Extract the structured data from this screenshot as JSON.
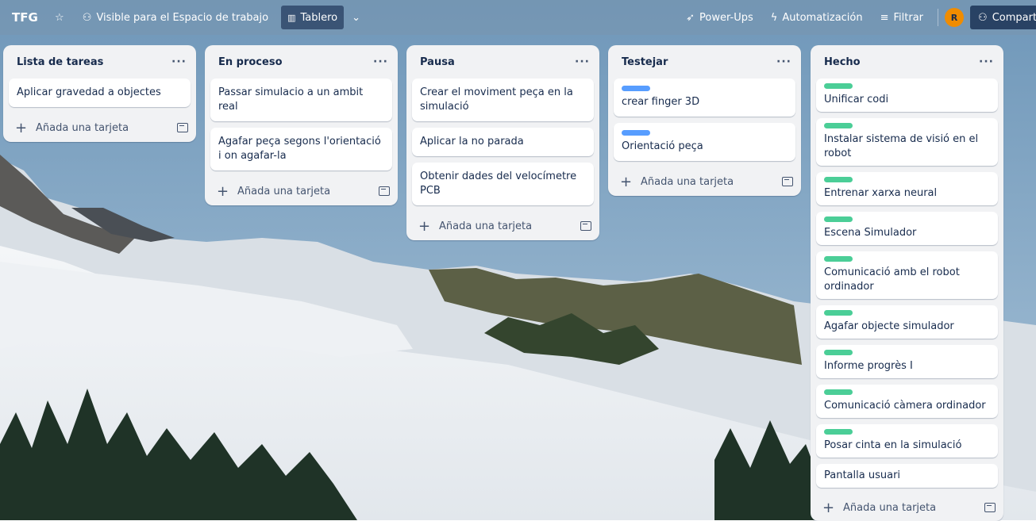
{
  "topbar": {
    "board_name": "TFG",
    "visibility_label": "Visible para el Espacio de trabajo",
    "view_label": "Tablero",
    "powerups_label": "Power-Ups",
    "automation_label": "Automatización",
    "filter_label": "Filtrar",
    "avatar_initial": "R",
    "share_label": "Compartir"
  },
  "lists": [
    {
      "title": "Lista de tareas",
      "cards": [
        {
          "text": "Aplicar gravedad a objectes"
        }
      ],
      "add_label": "Añada una tarjeta"
    },
    {
      "title": "En proceso",
      "cards": [
        {
          "text": "Passar simulacio a un ambit real"
        },
        {
          "text": "Agafar peça segons l'orientació i on agafar-la"
        }
      ],
      "add_label": "Añada una tarjeta"
    },
    {
      "title": "Pausa",
      "cards": [
        {
          "text": "Crear el moviment peça en la simulació"
        },
        {
          "text": "Aplicar la no parada"
        },
        {
          "text": "Obtenir dades del velocímetre PCB"
        }
      ],
      "add_label": "Añada una tarjeta"
    },
    {
      "title": "Testejar",
      "cards": [
        {
          "text": "crear finger 3D",
          "label_color": "blue"
        },
        {
          "text": "Orientació peça",
          "label_color": "blue"
        }
      ],
      "add_label": "Añada una tarjeta"
    },
    {
      "title": "Hecho",
      "cards": [
        {
          "text": "Unificar codi",
          "label_color": "green"
        },
        {
          "text": "Instalar sistema de visió en el robot",
          "label_color": "green"
        },
        {
          "text": "Entrenar xarxa neural",
          "label_color": "green"
        },
        {
          "text": "Escena Simulador",
          "label_color": "green"
        },
        {
          "text": "Comunicació amb el robot ordinador",
          "label_color": "green"
        },
        {
          "text": "Agafar objecte simulador",
          "label_color": "green"
        },
        {
          "text": "Informe progrès I",
          "label_color": "green"
        },
        {
          "text": "Comunicació càmera ordinador",
          "label_color": "green"
        },
        {
          "text": "Posar cinta en la simulació",
          "label_color": "green"
        },
        {
          "text": "Pantalla usuari"
        }
      ],
      "add_label": "Añada una tarjeta"
    }
  ],
  "colors": {
    "label_blue": "#579dff",
    "label_green": "#4bce97",
    "avatar_bg": "#f08c00"
  }
}
